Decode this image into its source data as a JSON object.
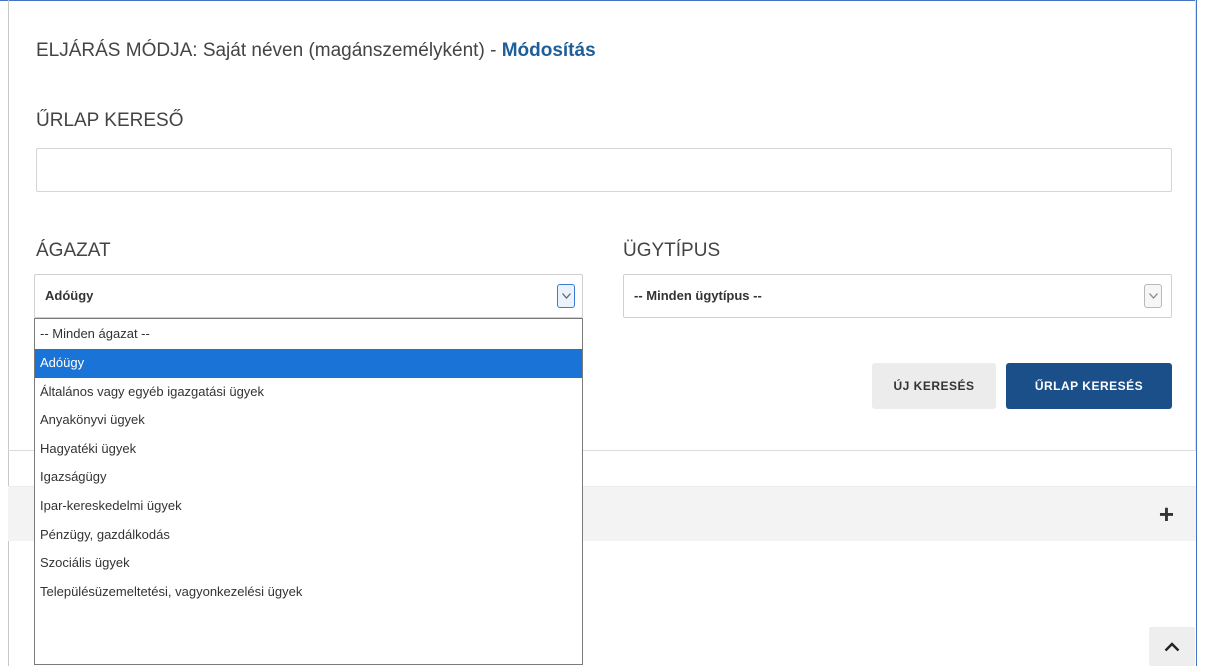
{
  "procedure": {
    "label": "ELJÁRÁS MÓDJA: Saját néven (magánszemélyként) - ",
    "link": "Módosítás"
  },
  "form_search": {
    "label": "ŰRLAP KERESŐ",
    "value": ""
  },
  "sector": {
    "label": "ÁGAZAT",
    "selected": "Adóügy",
    "options": [
      "-- Minden ágazat --",
      "Adóügy",
      "Általános vagy egyéb igazgatási ügyek",
      "Anyakönyvi ügyek",
      "Hagyatéki ügyek",
      "Igazságügy",
      "Ipar-kereskedelmi ügyek",
      "Pénzügy, gazdálkodás",
      "Szociális ügyek",
      "Településüzemeltetési, vagyonkezelési ügyek"
    ],
    "highlighted_option": "Adóügy"
  },
  "case_type": {
    "label": "ÜGYTÍPUS",
    "selected": "-- Minden ügytípus --"
  },
  "buttons": {
    "new_search": "ÚJ KERESÉS",
    "form_search": "ŰRLAP KERESÉS"
  },
  "icons": {
    "accordion_toggle": "plus-icon",
    "collapse_toggle": "chevron-up-icon",
    "select_arrow": "chevron-down-icon"
  },
  "colors": {
    "link": "#1f5f99",
    "primary_button": "#1b4f8a",
    "selected_option": "#1a73d6"
  }
}
